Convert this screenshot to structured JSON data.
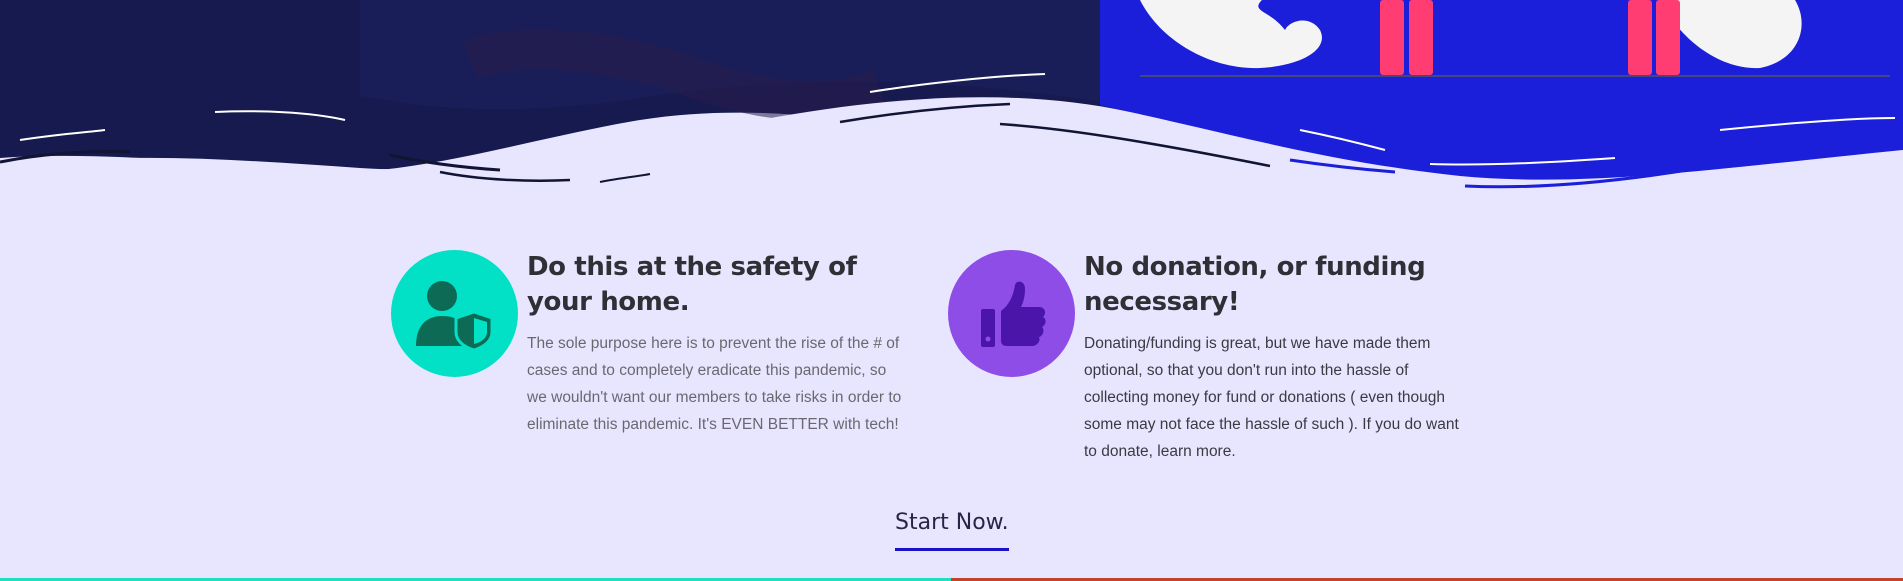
{
  "colors": {
    "page_background": "#e8e6ff",
    "hero_dark": "#161a4e",
    "hero_blue": "#1b1fd9",
    "accent_pink": "#ff3d72",
    "teal": "#02e0c6",
    "purple": "#8e4de6",
    "cta_underline": "#1b12c7"
  },
  "features": [
    {
      "icon": "user-shield-icon",
      "title": "Do this at the safety of your home.",
      "body": "The sole purpose here is to prevent the rise of the # of cases and to completely eradicate this pandemic, so we wouldn't want our members to take risks in order to eliminate this pandemic. It's EVEN BETTER with tech!"
    },
    {
      "icon": "thumbs-up-icon",
      "title": "No donation, or funding necessary!",
      "body": "Donating/funding is great, but we have made them optional, so that you don't run into the hassle of collecting money for fund or donations ( even though some may not face the hassle of such ). If you do want to donate, learn more."
    }
  ],
  "cta": {
    "label": "Start Now."
  }
}
